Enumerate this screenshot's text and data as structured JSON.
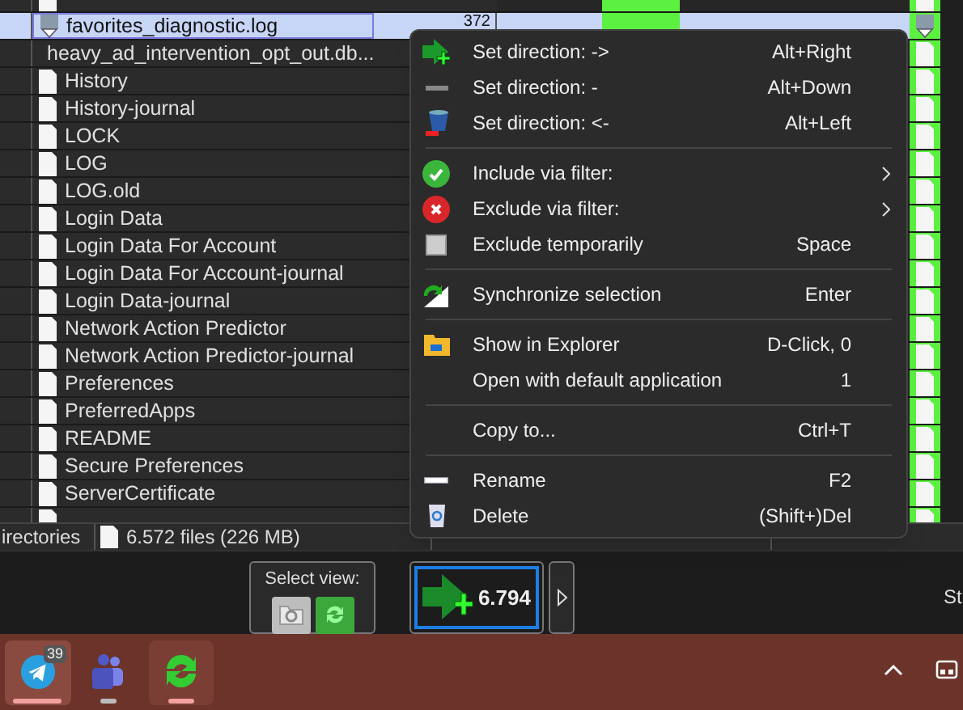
{
  "files": [
    {
      "name": "favorites_diagnostic.log",
      "size": "372",
      "kind": "special",
      "selected": true
    },
    {
      "name": "heavy_ad_intervention_opt_out.db...",
      "kind": "file",
      "selected": false
    },
    {
      "name": "History",
      "kind": "file",
      "selected": false
    },
    {
      "name": "History-journal",
      "kind": "file",
      "selected": false
    },
    {
      "name": "LOCK",
      "kind": "file",
      "selected": false
    },
    {
      "name": "LOG",
      "kind": "file",
      "selected": false
    },
    {
      "name": "LOG.old",
      "kind": "file",
      "selected": false
    },
    {
      "name": "Login Data",
      "kind": "file",
      "selected": false
    },
    {
      "name": "Login Data For Account",
      "kind": "file",
      "selected": false
    },
    {
      "name": "Login Data For Account-journal",
      "kind": "file",
      "selected": false
    },
    {
      "name": "Login Data-journal",
      "kind": "file",
      "selected": false
    },
    {
      "name": "Network Action Predictor",
      "kind": "file",
      "selected": false
    },
    {
      "name": "Network Action Predictor-journal",
      "kind": "file",
      "selected": false
    },
    {
      "name": "Preferences",
      "kind": "file",
      "selected": false
    },
    {
      "name": "PreferredApps",
      "kind": "file",
      "selected": false
    },
    {
      "name": "README",
      "kind": "file",
      "selected": false
    },
    {
      "name": "Secure Preferences",
      "kind": "file",
      "selected": false
    },
    {
      "name": "ServerCertificate",
      "kind": "file",
      "selected": false
    }
  ],
  "status_bar": {
    "directories": "irectories",
    "files": "6.572 files (226 MB)"
  },
  "context_menu": {
    "items": [
      {
        "kind": "item",
        "label": "Set direction: ->",
        "shortcut": "Alt+Right",
        "submenu": false
      },
      {
        "kind": "item",
        "label": "Set direction: -",
        "shortcut": "Alt+Down",
        "submenu": false
      },
      {
        "kind": "item",
        "label": "Set direction: <-",
        "shortcut": "Alt+Left",
        "submenu": false
      },
      {
        "kind": "separator"
      },
      {
        "kind": "item",
        "label": "Include via filter:",
        "submenu": true
      },
      {
        "kind": "item",
        "label": "Exclude via filter:",
        "submenu": true
      },
      {
        "kind": "item",
        "label": "Exclude temporarily",
        "shortcut": "Space",
        "submenu": false
      },
      {
        "kind": "separator"
      },
      {
        "kind": "item",
        "label": "Synchronize selection",
        "shortcut": "Enter",
        "submenu": false
      },
      {
        "kind": "separator"
      },
      {
        "kind": "item",
        "label": "Show in Explorer",
        "shortcut": "D-Click, 0",
        "submenu": false
      },
      {
        "kind": "item",
        "label": "Open with default application",
        "shortcut": "1",
        "submenu": false
      },
      {
        "kind": "separator"
      },
      {
        "kind": "item",
        "label": "Copy to...",
        "shortcut": "Ctrl+T",
        "submenu": false
      },
      {
        "kind": "separator"
      },
      {
        "kind": "item",
        "label": "Rename",
        "shortcut": "F2",
        "submenu": false
      },
      {
        "kind": "item",
        "label": "Delete",
        "shortcut": "(Shift+)Del",
        "submenu": false
      }
    ]
  },
  "toolbar": {
    "select_view_label": "Select view:",
    "count": "6.794",
    "right_text": "St"
  },
  "taskbar": {
    "badge": "39"
  }
}
